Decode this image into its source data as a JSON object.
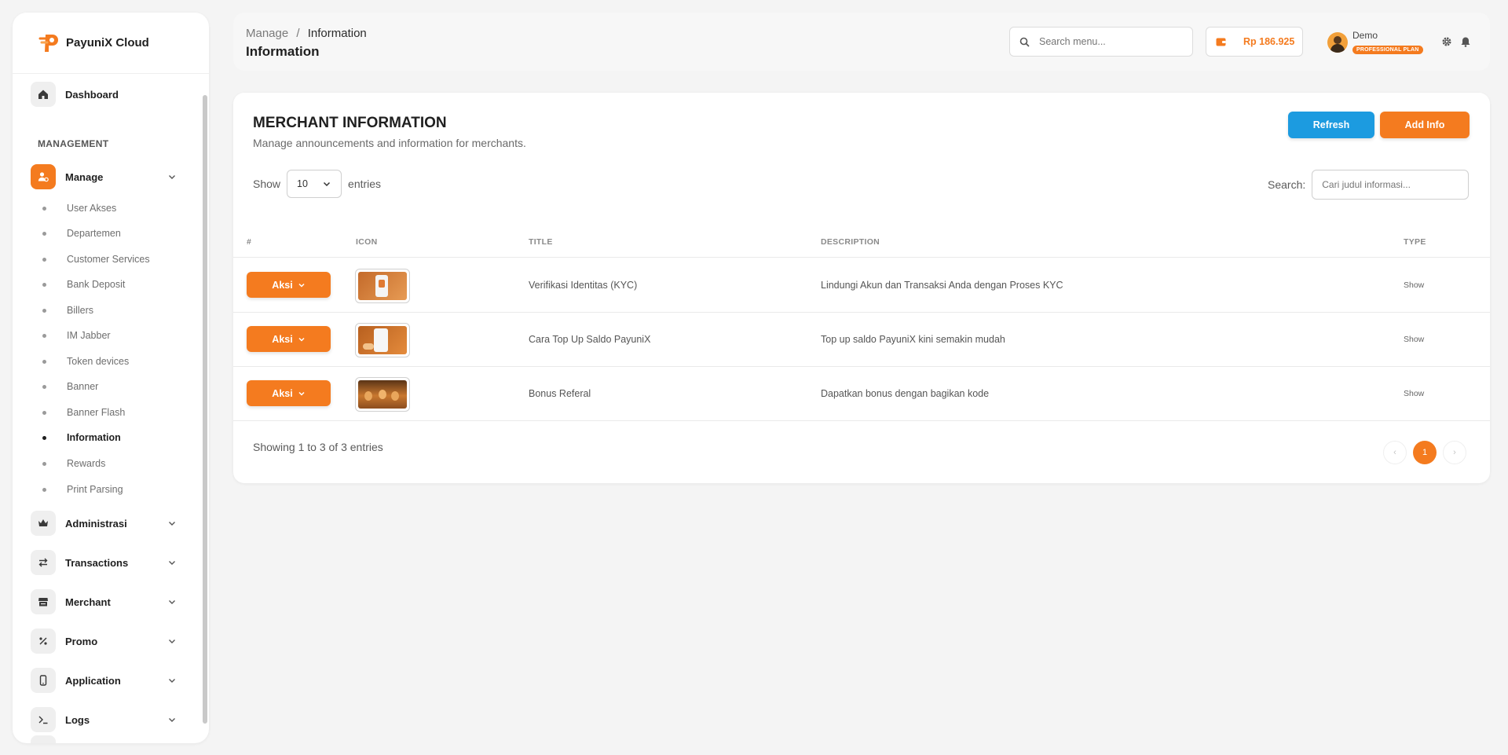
{
  "brand": {
    "name": "PayuniX Cloud"
  },
  "sidebar": {
    "dashboard": "Dashboard",
    "section": "MANAGEMENT",
    "manage": {
      "label": "Manage",
      "items": [
        "User Akses",
        "Departemen",
        "Customer Services",
        "Bank Deposit",
        "Billers",
        "IM Jabber",
        "Token devices",
        "Banner",
        "Banner Flash",
        "Information",
        "Rewards",
        "Print Parsing"
      ],
      "active_item": "Information"
    },
    "groups": [
      "Administrasi",
      "Transactions",
      "Merchant",
      "Promo",
      "Application",
      "Logs"
    ]
  },
  "header": {
    "breadcrumb_root": "Manage",
    "breadcrumb_sep": "/",
    "breadcrumb_current": "Information",
    "title": "Information",
    "search_placeholder": "Search menu...",
    "balance": "Rp 186.925",
    "user_name": "Demo",
    "user_plan": "PROFESSIONAL PLAN"
  },
  "card": {
    "title": "MERCHANT INFORMATION",
    "subtitle": "Manage announcements and information for merchants.",
    "refresh_label": "Refresh",
    "add_label": "Add Info",
    "show_label": "Show",
    "entries_value": "10",
    "entries_label": "entries",
    "search_label": "Search:",
    "search_placeholder": "Cari judul informasi...",
    "columns": [
      "#",
      "ICON",
      "TITLE",
      "DESCRIPTION",
      "TYPE"
    ],
    "rows": [
      {
        "action": "Aksi",
        "title": "Verifikasi Identitas (KYC)",
        "description": "Lindungi Akun dan Transaksi Anda dengan Proses KYC",
        "type": "Show"
      },
      {
        "action": "Aksi",
        "title": "Cara Top Up Saldo PayuniX",
        "description": "Top up saldo PayuniX kini semakin mudah",
        "type": "Show"
      },
      {
        "action": "Aksi",
        "title": "Bonus Referal",
        "description": "Dapatkan bonus dengan bagikan kode",
        "type": "Show"
      }
    ],
    "footer_info": "Showing 1 to 3 of 3 entries",
    "pagination": {
      "prev": "‹",
      "current": "1",
      "next": "›"
    }
  },
  "colors": {
    "accent": "#f47b1f",
    "info": "#1c9be0"
  },
  "icons": {
    "dashboard": "home-icon",
    "manage": "user-gear-icon",
    "administrasi": "crown-icon",
    "transactions": "swap-icon",
    "merchant": "store-icon",
    "promo": "percent-icon",
    "application": "phone-icon",
    "logs": "terminal-icon"
  }
}
